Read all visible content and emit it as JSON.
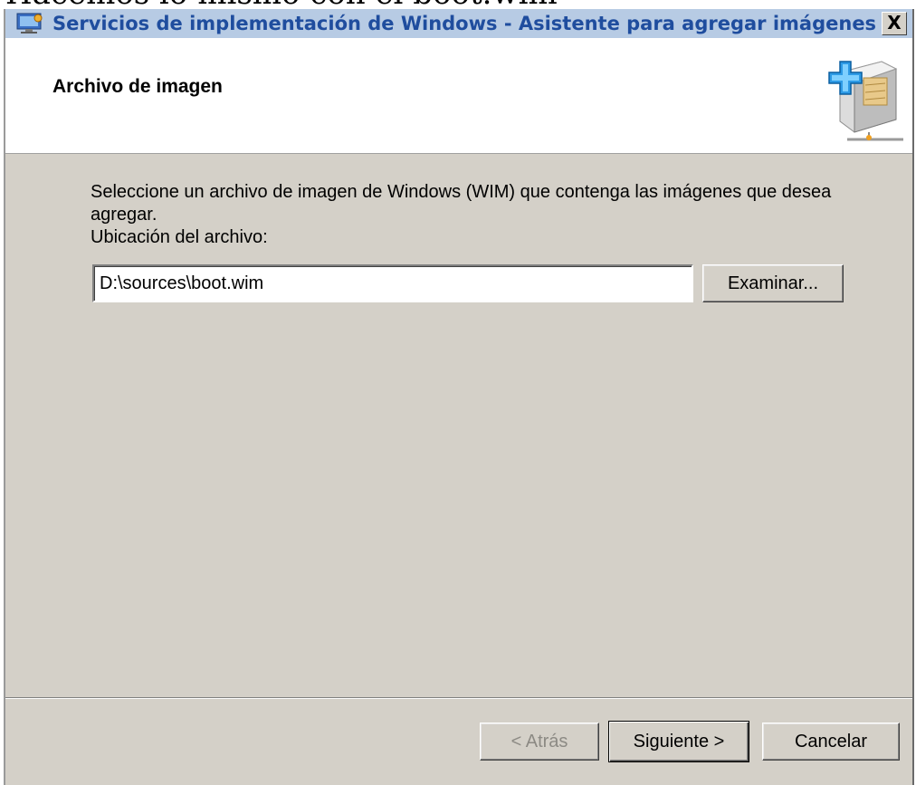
{
  "background_text": "Hacemos lo mismo con el boot.wim",
  "window": {
    "title": "Servicios de implementación de Windows - Asistente para agregar imágenes",
    "close_label": "X"
  },
  "header": {
    "title": "Archivo de imagen"
  },
  "content": {
    "instructions": "Seleccione un archivo de imagen de Windows (WIM) que contenga las imágenes que desea agregar.",
    "location_label": "Ubicación del archivo:",
    "file_path": "D:\\sources\\boot.wim",
    "browse_label": "Examinar..."
  },
  "footer": {
    "back_label": "< Atrás",
    "next_label": "Siguiente >",
    "cancel_label": "Cancelar"
  },
  "colors": {
    "dialog_bg": "#d4d0c8",
    "title_text": "#1f4d9e",
    "titlebar_bg": "#b7cbe4"
  }
}
